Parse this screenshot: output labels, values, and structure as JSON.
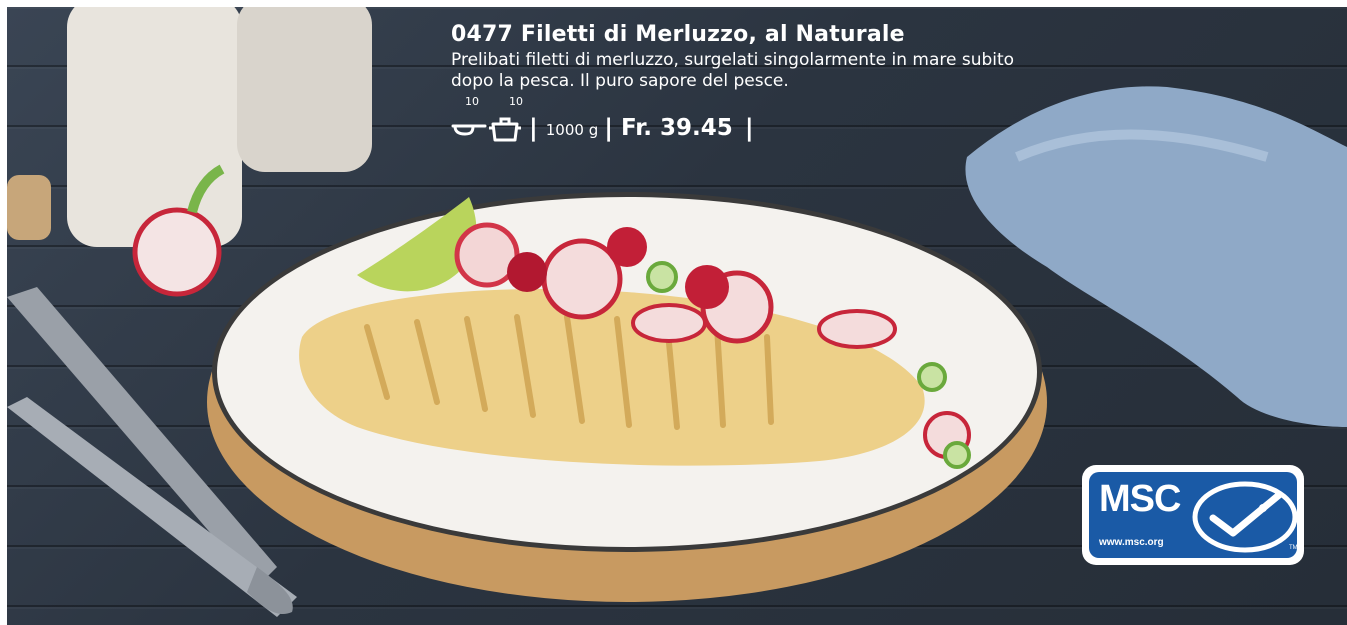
{
  "product": {
    "title": "0477 Filetti di Merluzzo, al Naturale",
    "description": "Prelibati filetti di merluzzo, surgelati singolarmente in mare subito dopo la pesca. Il puro sapore del pesce.",
    "pan_time": "10",
    "oven_time": "10",
    "pan_icon": "frying-pan-icon",
    "oven_icon": "cooking-pot-icon",
    "separator": "|",
    "weight": "1000 g",
    "price": "Fr. 39.45"
  },
  "badge": {
    "brand": "MSC",
    "url": "www.msc.org",
    "tm": "TM",
    "color": "#1a5aa6"
  },
  "colors": {
    "background": "#2b3440",
    "text": "#ffffff"
  }
}
